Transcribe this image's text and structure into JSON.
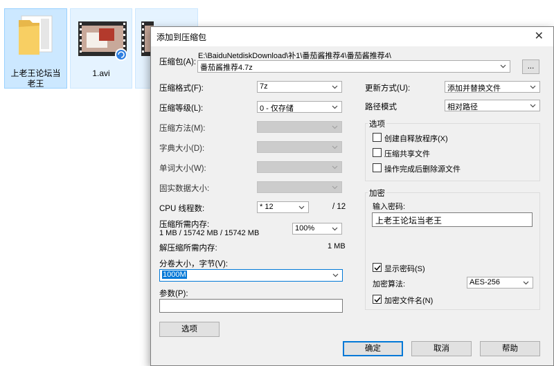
{
  "desktop": {
    "files": [
      {
        "name": "上老王论坛当老王",
        "icon": "folder-icon"
      },
      {
        "name": "1.avi",
        "icon": "video-file-icon"
      },
      {
        "name": "",
        "icon": "video-file-icon"
      }
    ]
  },
  "dialog": {
    "title": "添加到压缩包",
    "archive_label": "压缩包(A):",
    "archive_path": "E:\\BaiduNetdiskDownload\\补1\\番茄酱推荐4\\番茄酱推荐4\\",
    "archive_name": "番茄酱推荐4.7z",
    "browse_label": "...",
    "left": {
      "format_label": "压缩格式(F):",
      "format_value": "7z",
      "level_label": "压缩等级(L):",
      "level_value": "0 - 仅存储",
      "method_label": "压缩方法(M):",
      "dict_label": "字典大小(D):",
      "word_label": "单词大小(W):",
      "solid_label": "固实数据大小:",
      "cpu_label": "CPU 线程数:",
      "cpu_value": "* 12",
      "cpu_max": "/ 12",
      "mem_comp_label": "压缩所需内存:",
      "mem_comp_detail": "1 MB / 15742 MB / 15742 MB",
      "mem_percent": "100%",
      "mem_decomp_label": "解压缩所需内存:",
      "mem_decomp_value": "1 MB",
      "split_label": "分卷大小，字节(V):",
      "split_value": "1000M",
      "params_label": "参数(P):",
      "params_value": "",
      "options_button": "选项"
    },
    "right": {
      "update_label": "更新方式(U):",
      "update_value": "添加并替换文件",
      "path_label": "路径模式",
      "path_value": "相对路径",
      "options_group": "选项",
      "opt_sfx": "创建自释放程序(X)",
      "opt_shared": "压缩共享文件",
      "opt_delete": "操作完成后删除源文件",
      "encrypt_group": "加密",
      "password_label": "输入密码:",
      "password_value": "上老王论坛当老王",
      "show_password": "显示密码(S)",
      "algo_label": "加密算法:",
      "algo_value": "AES-256",
      "encrypt_names": "加密文件名(N)"
    },
    "ok_button": "确定",
    "cancel_button": "取消",
    "help_button": "帮助"
  },
  "colors": {
    "accent": "#0078d7",
    "dialog_bg": "#f0f0f0",
    "selection_bg": "#cce8ff"
  }
}
